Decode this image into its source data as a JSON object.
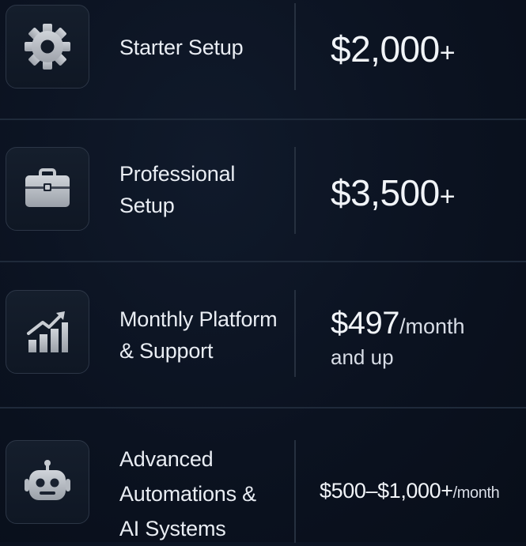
{
  "plans": [
    {
      "name_lines": [
        "Starter Setup"
      ],
      "price_main": "$2,000",
      "price_suffix": "+",
      "icon": "gear-icon"
    },
    {
      "name_lines": [
        "Professional",
        "Setup"
      ],
      "price_main": "$3,500",
      "price_suffix": "+",
      "icon": "briefcase-icon"
    },
    {
      "name_lines": [
        "Monthly Platform",
        "& Support"
      ],
      "price_main": "$497",
      "price_unit": "/month",
      "price_note": "and up",
      "icon": "growth-chart-icon"
    },
    {
      "name_lines": [
        "Advanced",
        "Automations &",
        "AI Systems"
      ],
      "price_main": "$500–$1,000+",
      "price_unit": "/month",
      "icon": "robot-icon"
    }
  ],
  "colors": {
    "background": "#0b1220",
    "divider": "#1f2a3a",
    "icon": "#b9bec6",
    "text": "#e9edf3"
  }
}
